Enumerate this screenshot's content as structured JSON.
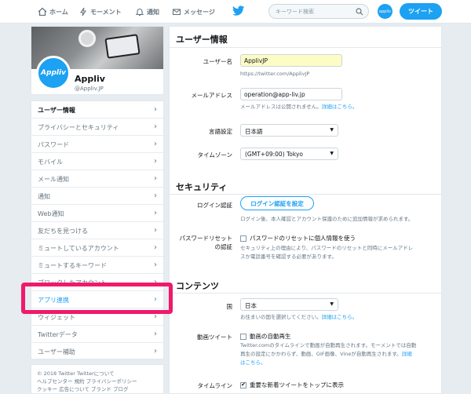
{
  "nav": {
    "home": "ホーム",
    "moments": "モーメント",
    "notifications": "通知",
    "messages": "メッセージ",
    "search_placeholder": "キーワード検索",
    "avatar_text": "appliv",
    "tweet": "ツイート"
  },
  "profile": {
    "avatar_text": "Appliv",
    "name": "Appliv",
    "handle": "@Appliv.JP"
  },
  "menu": {
    "items": [
      {
        "label": "ユーザー情報"
      },
      {
        "label": "プライバシーとセキュリティ"
      },
      {
        "label": "パスワード"
      },
      {
        "label": "モバイル"
      },
      {
        "label": "メール通知"
      },
      {
        "label": "通知"
      },
      {
        "label": "Web通知"
      },
      {
        "label": "友だちを見つける"
      },
      {
        "label": "ミュートしているアカウント"
      },
      {
        "label": "ミュートするキーワード"
      },
      {
        "label": "ブロックしたアカウント"
      },
      {
        "label": "アプリ連携"
      },
      {
        "label": "ウィジェット"
      },
      {
        "label": "Twitterデータ"
      },
      {
        "label": "ユーザー補助"
      }
    ]
  },
  "footer": {
    "line1": "© 2018 Twitter  Twitterについて",
    "line2": "ヘルプセンター  規約  プライバシーポリシー",
    "line3": "クッキー  広告について  ブランド  ブログ"
  },
  "user_info": {
    "title": "ユーザー情報",
    "username_label": "ユーザー名",
    "username_value": "ApplivJP",
    "username_url": "https://twitter.com/ApplivJP",
    "email_label": "メールアドレス",
    "email_value": "operation@app-liv.jp",
    "email_hint": "メールアドレスは公開されません。",
    "email_hint_link": "詳細はこちら。",
    "language_label": "言語設定",
    "language_value": "日本語",
    "timezone_label": "タイムゾーン",
    "timezone_value": "(GMT+09:00) Tokyo"
  },
  "security": {
    "title": "セキュリティ",
    "login_verify_label": "ログイン認証",
    "login_verify_button": "ログイン認証を設定",
    "login_verify_hint": "ログイン後、本人確認とアカウント保護のために追加情報が求められます。",
    "password_reset_label_1": "パスワードリセット",
    "password_reset_label_2": "の認証",
    "password_reset_check": "パスワードのリセットに個人情報を使う",
    "password_reset_hint_1": "セキュリティ上の理由により、パスワードのリセットと同時にメールアドレ",
    "password_reset_hint_2": "スか電話番号を確認する必要があります。"
  },
  "content": {
    "title": "コンテンツ",
    "country_label": "国",
    "country_value": "日本",
    "country_hint": "お住まいの国を選択してください。",
    "country_hint_link": "詳細はこちら。",
    "video_label": "動画ツイート",
    "video_check": "動画の自動再生",
    "video_hint_1": "Twitter.comのタイムラインで動画が自動再生されます。モーメントでは自動",
    "video_hint_2": "再生の設定にかかわらず、動画、GIF画像、Vineが自動再生されます。",
    "video_hint_link_a": "詳細",
    "video_hint_link_b": "はこちら。",
    "timeline_label": "タイムライン",
    "timeline_check": "重要な新着ツイートをトップに表示"
  },
  "colors": {
    "accent": "#1da1f2",
    "highlight": "#f0196b"
  }
}
